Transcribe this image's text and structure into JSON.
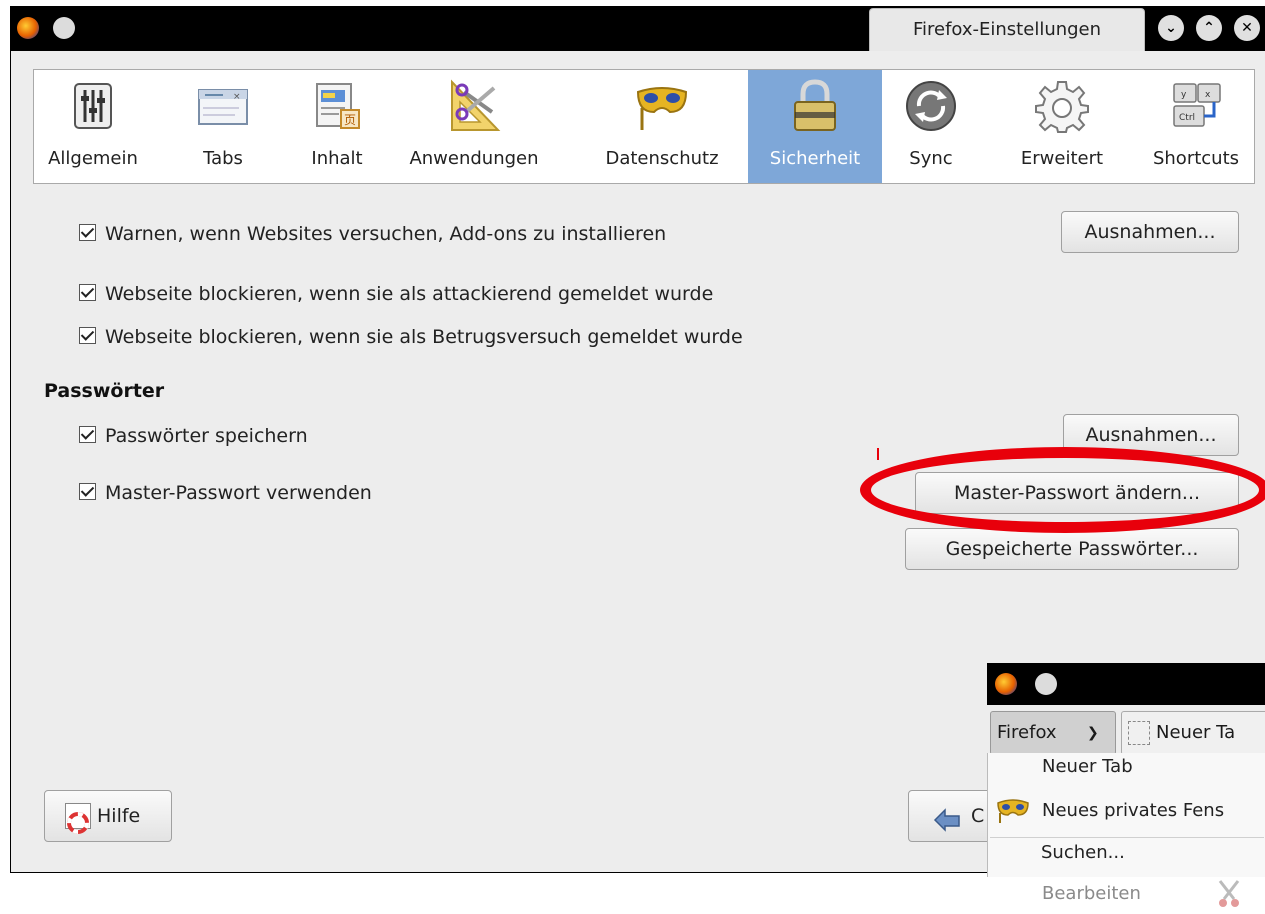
{
  "window": {
    "title": "Firefox-Einstellungen",
    "controls": [
      "minimize-icon",
      "maximize-icon",
      "close-icon"
    ]
  },
  "toolbar": {
    "items": [
      {
        "label": "Allgemein",
        "icon": "sliders-icon"
      },
      {
        "label": "Tabs",
        "icon": "tabs-icon"
      },
      {
        "label": "Inhalt",
        "icon": "content-icon"
      },
      {
        "label": "Anwendungen",
        "icon": "applications-icon"
      },
      {
        "label": "Datenschutz",
        "icon": "privacy-mask-icon"
      },
      {
        "label": "Sicherheit",
        "icon": "padlock-icon",
        "active": true
      },
      {
        "label": "Sync",
        "icon": "sync-icon"
      },
      {
        "label": "Erweitert",
        "icon": "gear-icon"
      },
      {
        "label": "Shortcuts",
        "icon": "keyboard-keys-icon"
      }
    ]
  },
  "security": {
    "warn_addons": {
      "label": "Warnen, wenn Websites versuchen, Add-ons zu installieren",
      "checked": true
    },
    "exceptions_button": "Ausnahmen...",
    "block_attack": {
      "label": "Webseite blockieren, wenn sie als attackierend gemeldet wurde",
      "checked": true
    },
    "block_fraud": {
      "label": "Webseite blockieren, wenn sie als Betrugsversuch gemeldet wurde",
      "checked": true
    }
  },
  "passwords": {
    "heading": "Passwörter",
    "save": {
      "label": "Passwörter speichern",
      "checked": true
    },
    "exceptions_button": "Ausnahmen...",
    "master": {
      "label": "Master-Passwort verwenden",
      "checked": true
    },
    "change_master_button": "Master-Passwort ändern...",
    "saved_passwords_button": "Gespeicherte Passwörter..."
  },
  "footer": {
    "help_button": "Hilfe",
    "close_button_partial": "C"
  },
  "popup": {
    "firefox_button": "Firefox",
    "tab_label": "Neuer Ta",
    "menu": {
      "new_tab": "Neuer Tab",
      "new_private": "Neues privates Fens",
      "edit": "Bearbeiten",
      "find": "Suchen..."
    }
  },
  "colors": {
    "active_tab": "#7ea7d8",
    "highlight_ring": "#e8000b",
    "titlebar": "#000000"
  }
}
